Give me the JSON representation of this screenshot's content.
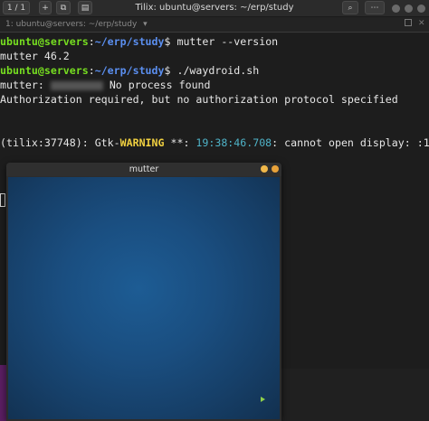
{
  "titlebar": {
    "session_counter": "1 / 1",
    "add_label": "+",
    "title": "Tilix: ubuntu@servers: ~/erp/study",
    "search_label": "⌕",
    "more_label": "⋯"
  },
  "tab": {
    "label": "1: ubuntu@servers: ~/erp/study",
    "dropdown": "▾"
  },
  "terminal": {
    "lines": [
      {
        "user": "ubuntu@servers",
        "path": "~/erp/study",
        "cmd": "mutter --version"
      },
      {
        "text": "mutter 46.2"
      },
      {
        "user": "ubuntu@servers",
        "path": "~/erp/study",
        "cmd": "./waydroid.sh"
      },
      {
        "prefix": "mutter: ",
        "text": " No process found"
      },
      {
        "text": "Authorization required, but no authorization protocol specified"
      },
      {
        "pre": "(tilix:37748): Gtk-",
        "warn": "WARNING",
        "mid": " **: ",
        "ts": "19:38:46.708",
        "post": ": cannot open display: :1"
      }
    ]
  },
  "mutter_window": {
    "title": "mutter"
  },
  "colors": {
    "prompt_user": "#76dd20",
    "prompt_path": "#5b8ff0",
    "warning": "#f0d040",
    "timestamp": "#4fb3c8",
    "close_dot": "#e8a23a",
    "min_dot": "#f0b84a"
  }
}
